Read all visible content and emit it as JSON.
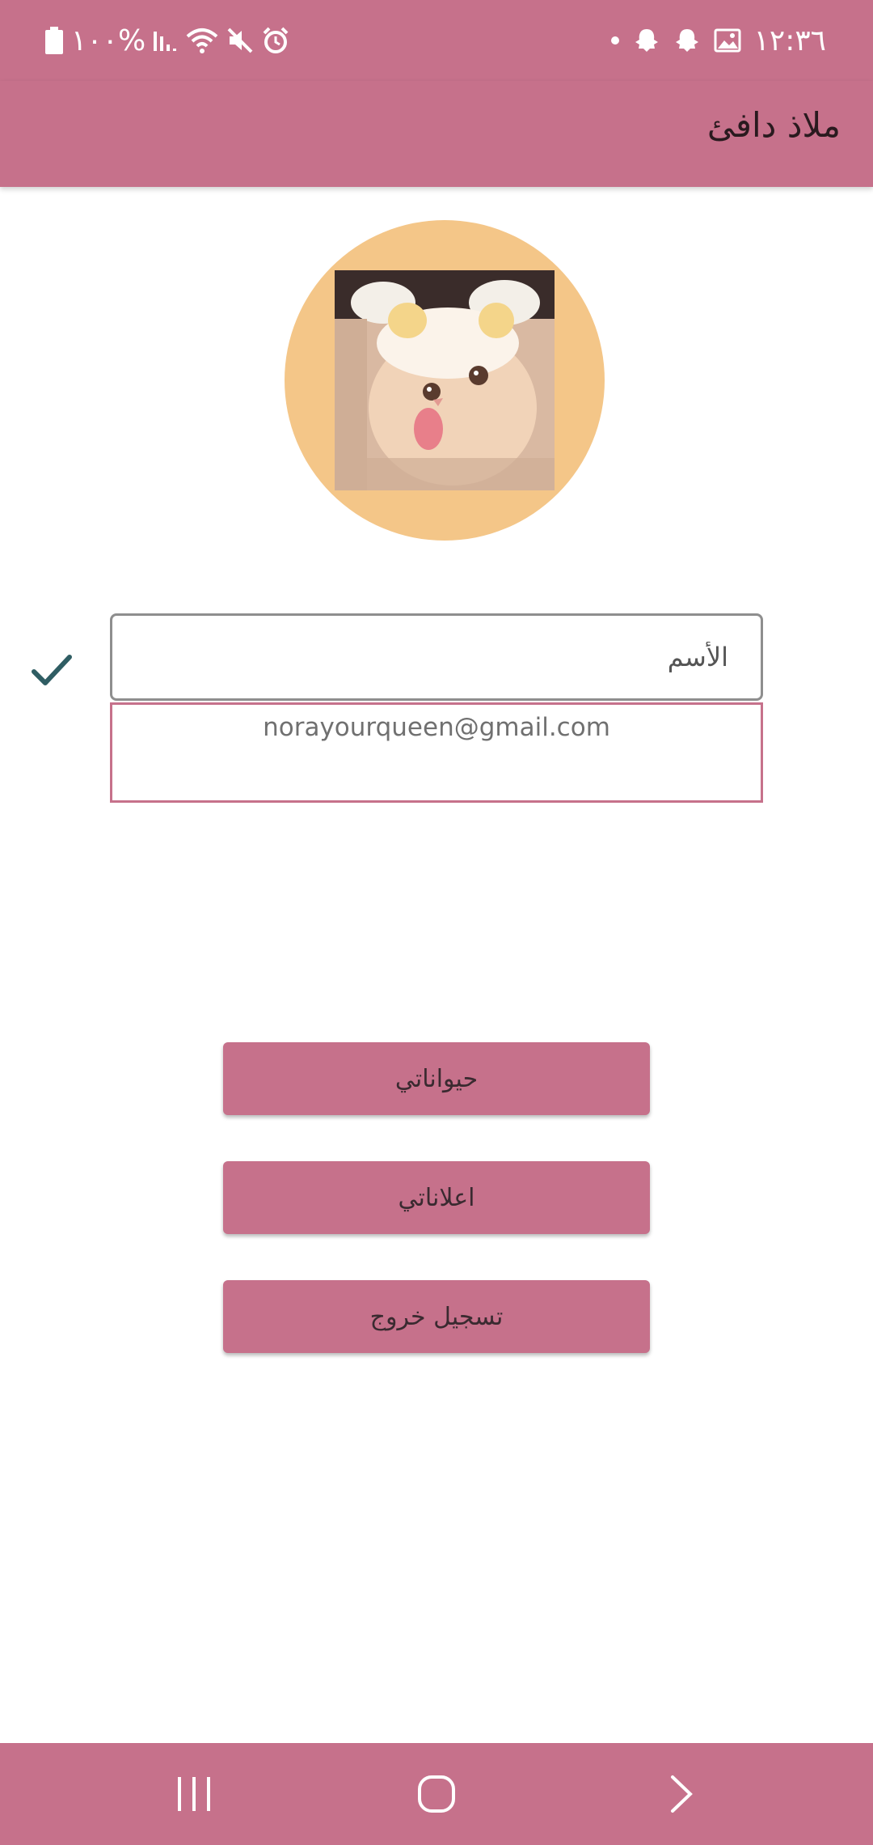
{
  "status_bar": {
    "time": "١٢:٣٦",
    "battery": "%١٠٠",
    "icons": [
      "battery-icon",
      "signal-icon",
      "wifi-icon",
      "mute-icon",
      "alarm-icon",
      "notification-dot-icon",
      "snapchat-icon",
      "snapchat-icon",
      "gallery-icon"
    ]
  },
  "app_bar": {
    "title": "ملاذ دافئ"
  },
  "profile": {
    "avatar_description": "profile photo of cat",
    "name_placeholder": "الأسم",
    "email": "norayourqueen@gmail.com"
  },
  "buttons": {
    "my_pets": "حيواناتي",
    "my_ads": "اعلاناتي",
    "logout": "تسجيل خروج"
  },
  "nav_bar": {
    "icons": [
      "recents-icon",
      "home-icon",
      "back-icon"
    ]
  },
  "colors": {
    "primary": "#c6718b",
    "avatar_bg": "#f4c688",
    "check": "#2f5d63",
    "text_dark": "#2a1a1f"
  }
}
